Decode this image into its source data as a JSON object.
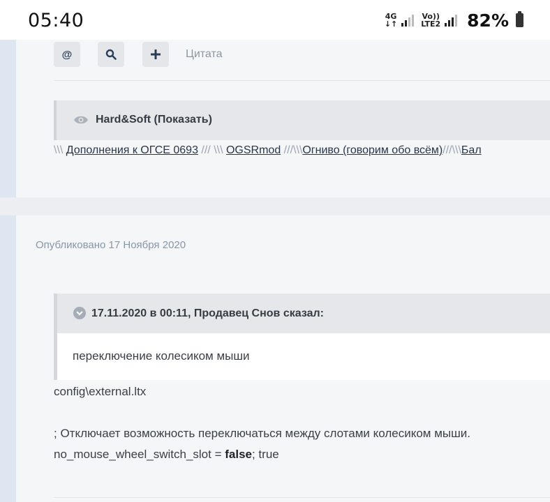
{
  "status_bar": {
    "time": "05:40",
    "net1_top": "4G",
    "net1_bottom": "↓↑",
    "net2_top": "Vo))",
    "net2_bottom": "LTE2",
    "battery_percent": "82%"
  },
  "post1": {
    "toolbar": {
      "mention_label": "@",
      "quote_label": "Цитата"
    },
    "spoiler_title": "Hard&Soft (Показать)",
    "signature": {
      "sep1": "\\\\\\ ",
      "link1": "Дополнения к ОГСЕ 0693",
      "sep2": " /// \\\\\\ ",
      "link2": "OGSRmod",
      "sep3": " ///\\\\\\",
      "link3": "Огниво (говорим обо всём)",
      "sep4": "///\\\\\\",
      "link4": "Бал"
    }
  },
  "post2": {
    "published": "Опубликовано 17 Ноября 2020",
    "quote_header": "17.11.2020 в 00:11, Продавец Снов сказал:",
    "quote_text": "переключение колесиком мыши",
    "line1": "config\\external.ltx",
    "line2": "; Отключает возможность переключаться между слотами колесиком мыши.",
    "line3_pre": "no_mouse_wheel_switch_slot = ",
    "line3_bold": "false",
    "line3_post": "; true"
  },
  "colors": {
    "rail": "#dde6f1",
    "page_bg": "#f5f6f8",
    "box_bg": "#e6e7ea",
    "meta_text": "#8796a8"
  }
}
